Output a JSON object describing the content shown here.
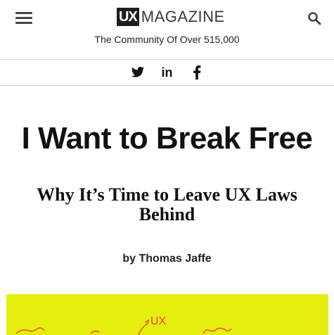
{
  "header": {
    "logo_badge": "UX",
    "logo_word": "MAGAZINE",
    "tagline": "The Community Of Over 515,000",
    "menu_icon": "hamburger-menu-icon",
    "search_icon": "search-icon"
  },
  "social": [
    {
      "name": "twitter-icon"
    },
    {
      "name": "linkedin-icon",
      "label": "in"
    },
    {
      "name": "facebook-icon"
    }
  ],
  "article": {
    "title": "I Want to Break Free",
    "subtitle": "Why It’s Time to Leave UX Laws Behind",
    "byline_prefix": "by",
    "author": "Thomas Jaffe"
  },
  "hero": {
    "background": "#e6ee0e",
    "sketch_text": "UX"
  },
  "colors": {
    "text": "#111111",
    "divider": "#d6d6d6",
    "sketch": "#e3452a"
  }
}
